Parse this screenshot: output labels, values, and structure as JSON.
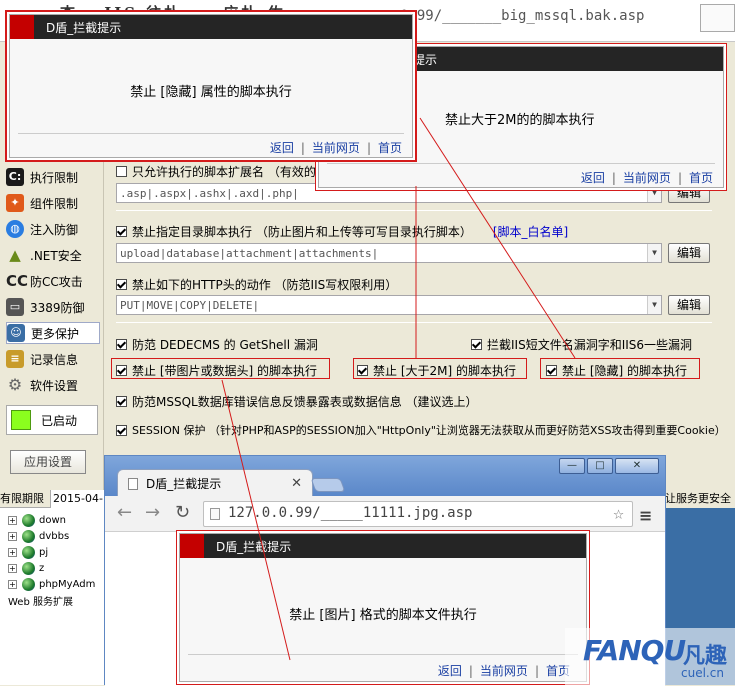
{
  "top": {
    "garbled": "杏﹑ IIS 往扑 ... 应扑 佐",
    "url": "0.99/_______big_mssql.bak.asp"
  },
  "sidebar": {
    "items": [
      {
        "label": "执行限制",
        "icon": "terminal-icon",
        "color": "#1a1a1a"
      },
      {
        "label": "组件限制",
        "icon": "puzzle-icon",
        "color": "#e05a1a"
      },
      {
        "label": "注入防御",
        "icon": "globe-icon",
        "color": "#2a7de1"
      },
      {
        "label": ".NET安全",
        "icon": "triangle-icon",
        "color": "#6a8a1a"
      },
      {
        "label": "防CC攻击",
        "icon": "cc-icon",
        "color": "#333333"
      },
      {
        "label": "3389防御",
        "icon": "monitor-icon",
        "color": "#555555"
      },
      {
        "label": "更多保护",
        "icon": "users-icon",
        "color": "#3a6ea5"
      },
      {
        "label": "记录信息",
        "icon": "log-icon",
        "color": "#c89b2a"
      },
      {
        "label": "软件设置",
        "icon": "gear-icon",
        "color": "#666666"
      }
    ],
    "status": "已启动",
    "apply": "应用设置"
  },
  "main": {
    "allow_ext_label": "只允许执行的脚本扩展名 （有效的",
    "allow_ext_value": ".asp|.aspx|.ashx|.axd|.php|",
    "dir_label": "禁止指定目录脚本执行 （防止图片和上传等可写目录执行脚本）",
    "dir_link": "[脚本_白名单]",
    "dir_value": "upload|database|attachment|attachments|",
    "http_label": "禁止如下的HTTP头的动作 （防范IIS写权限利用）",
    "http_value": "PUT|MOVE|COPY|DELETE|",
    "edit": "编辑",
    "dedecms": "防范 DEDECMS 的 GetShell 漏洞",
    "iis_short": "拦截IIS短文件名漏洞字和IIS6一些漏洞",
    "no_img_db": "禁止 [带图片或数据头] 的脚本执行",
    "no_2m": "禁止 [大于2M] 的脚本执行",
    "no_hidden": "禁止 [隐藏] 的脚本执行",
    "mssql": "防范MSSQL数据库错误信息反馈暴露表或数据信息 （建议选上）",
    "session": "SESSION 保护 （针对PHP和ASP的SESSION加入\"HttpOnly\"让浏览器无法获取从而更好防范XSS攻击得到重要Cookie）"
  },
  "bottom": {
    "tree_head": "有限期限",
    "date": "2015-04-",
    "right_note": "让服务更安全",
    "tree_items": [
      "down",
      "dvbbs",
      "pj",
      "z",
      "phpMyAdm",
      "Web 服务扩展"
    ]
  },
  "chrome": {
    "tab_title": "D盾_拦截提示",
    "url": "127.0.0.99/_____11111.jpg.asp",
    "window_buttons": [
      "—",
      "□",
      "✕"
    ]
  },
  "popups": [
    {
      "title": "D盾_拦截提示",
      "message": "禁止 [隐藏] 属性的脚本执行",
      "links": [
        "返回",
        "当前网页",
        "首页"
      ]
    },
    {
      "title": "提示",
      "message": "禁止大于2M的的脚本执行",
      "links": [
        "返回",
        "当前网页",
        "首页"
      ]
    },
    {
      "title": "D盾_拦截提示",
      "message": "禁止 [图片] 格式的脚本文件执行",
      "links": [
        "返回",
        "当前网页",
        "首页"
      ]
    }
  ],
  "watermark": {
    "brand": "FANQU",
    "cn": "凡趣",
    "domain": "cuel.cn"
  },
  "colors": {
    "annotation_red": "#d41b1b",
    "popup_bar": "#252525",
    "popup_accent": "#c40000",
    "link_blue": "#1a3fa3",
    "status_green": "#8bff1e"
  }
}
